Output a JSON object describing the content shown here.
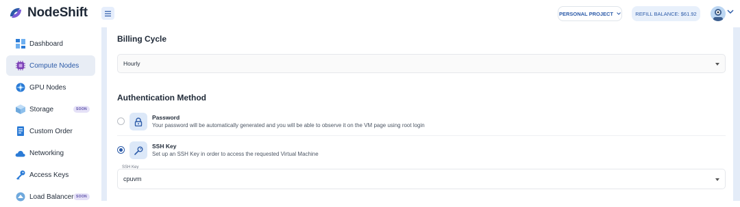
{
  "app": {
    "name": "NodeShift"
  },
  "header": {
    "project_label": "PERSONAL PROJECT",
    "refill_label": "REFILL BALANCE:",
    "refill_amount": "$61.92",
    "menu_icon": "hamburger-icon",
    "accent": "#2b5aa8"
  },
  "sidebar": {
    "items": [
      {
        "label": "Dashboard",
        "icon": "dashboard-icon"
      },
      {
        "label": "Compute Nodes",
        "icon": "chip-icon",
        "active": true
      },
      {
        "label": "GPU Nodes",
        "icon": "gpu-icon"
      },
      {
        "label": "Storage",
        "icon": "storage-icon",
        "badge": "SOON"
      },
      {
        "label": "Custom Order",
        "icon": "document-icon"
      },
      {
        "label": "Networking",
        "icon": "cloud-icon"
      },
      {
        "label": "Access Keys",
        "icon": "key-icon"
      },
      {
        "label": "Load Balancer",
        "icon": "balancer-icon",
        "badge": "SOON"
      }
    ]
  },
  "billing": {
    "title": "Billing Cycle",
    "value": "Hourly"
  },
  "auth": {
    "title": "Authentication Method",
    "options": [
      {
        "title": "Password",
        "desc": "Your password will be automatically generated and you will be able to observe it on the VM page using root login",
        "icon": "lock-icon",
        "selected": false
      },
      {
        "title": "SSH Key",
        "desc": "Set up an SSH Key in order to access the requested Virtual Machine",
        "icon": "key-icon",
        "selected": true
      }
    ],
    "ssh_field_label": "SSH Key",
    "ssh_value": "cpuvm"
  }
}
